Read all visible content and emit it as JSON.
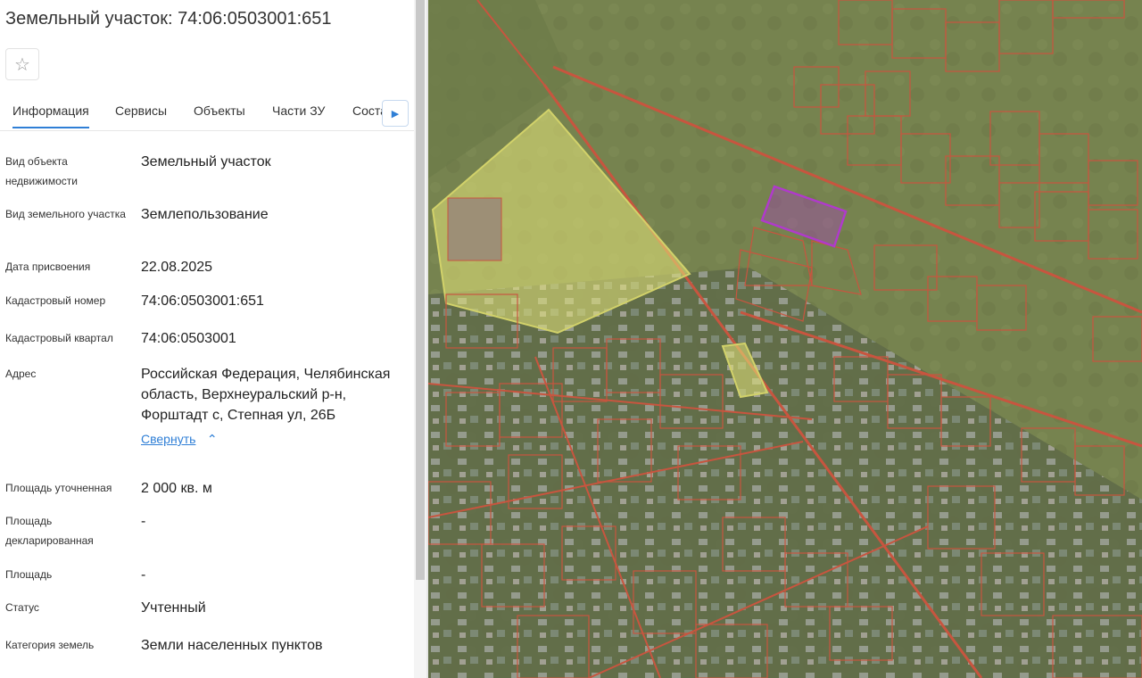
{
  "title": "Земельный участок: 74:06:0503001:651",
  "tabs": [
    {
      "label": "Информация"
    },
    {
      "label": "Сервисы"
    },
    {
      "label": "Объекты"
    },
    {
      "label": "Части ЗУ"
    },
    {
      "label": "Состав ЗУ"
    }
  ],
  "fields": [
    {
      "label": "Вид объекта недвижимости",
      "value": "Земельный участок"
    },
    {
      "label": "Вид земельного участка",
      "value": "Землепользование"
    },
    {
      "label": "Дата присвоения",
      "value": "22.08.2025"
    },
    {
      "label": "Кадастровый номер",
      "value": "74:06:0503001:651"
    },
    {
      "label": "Кадастровый квартал",
      "value": "74:06:0503001"
    },
    {
      "label": "Адрес",
      "value": "Российская Федерация, Челябинская область, Верхнеуральский р-н, Форштадт с, Степная ул, 26Б"
    },
    {
      "label": "Площадь уточненная",
      "value": "2 000 кв. м"
    },
    {
      "label": "Площадь декларированная",
      "value": "-"
    },
    {
      "label": "Площадь",
      "value": "-"
    },
    {
      "label": "Статус",
      "value": "Учтенный"
    },
    {
      "label": "Категория земель",
      "value": "Земли населенных пунктов"
    }
  ],
  "collapse_link": "Свернуть",
  "icons": {
    "favorite": "star-icon",
    "tabs_next": "caret-right-icon",
    "collapse": "chevron-up-icon"
  },
  "colors": {
    "accent": "#2f7fd6",
    "parcel_border": "#c8553f",
    "selected_parcel": "#b03acb",
    "highlight_area": "#e6e67a"
  }
}
